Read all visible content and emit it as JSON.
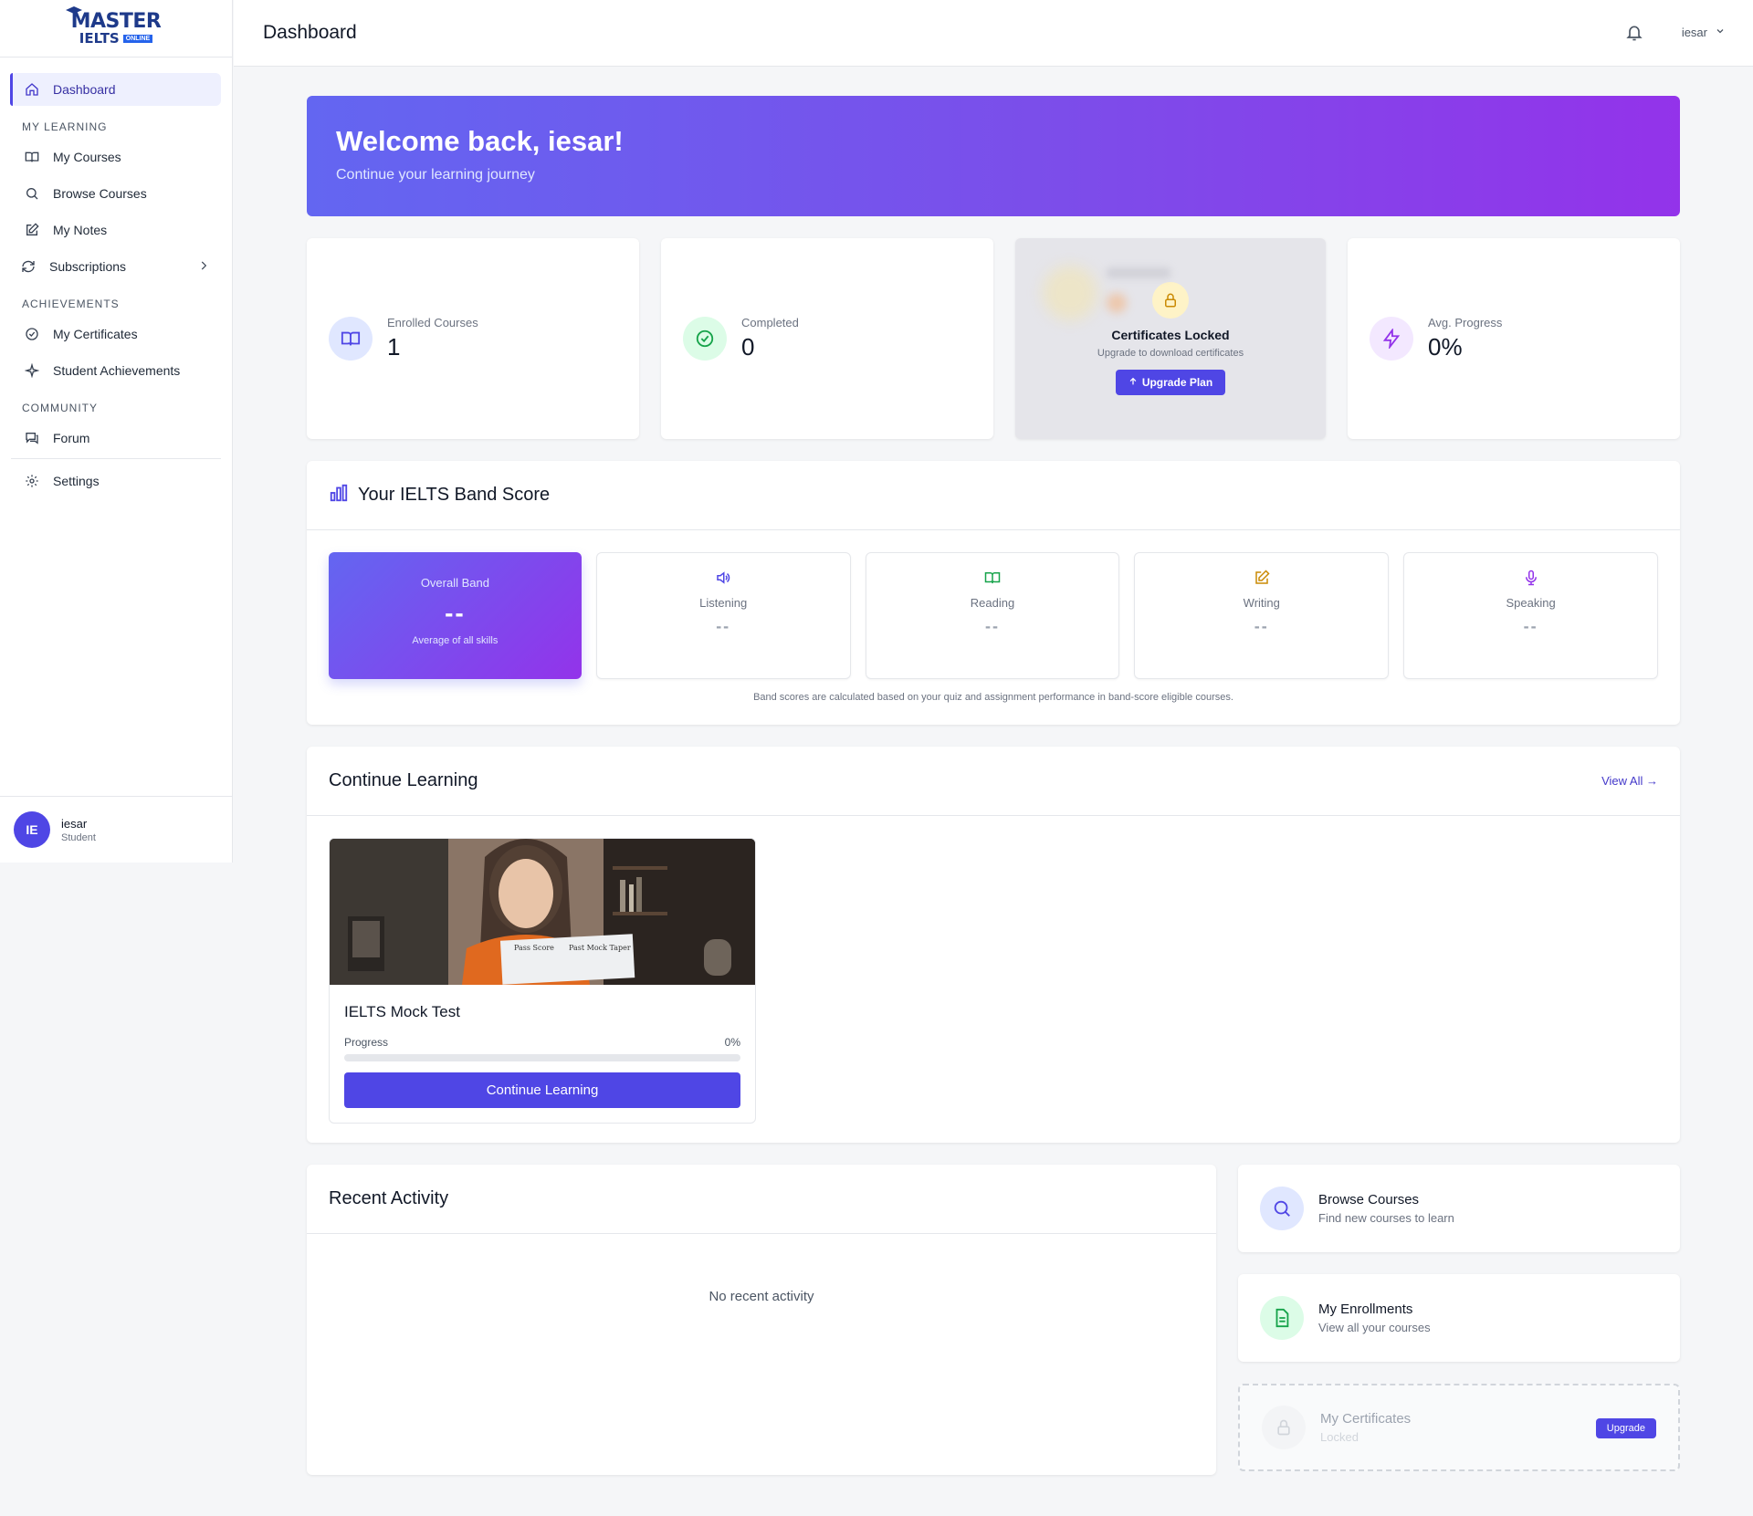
{
  "logo": {
    "master": "MASTER",
    "ielts": "IELTS",
    "online": "ONLINE"
  },
  "sidebar": {
    "dashboard": "Dashboard",
    "sections": {
      "learning": "MY LEARNING",
      "achievements": "ACHIEVEMENTS",
      "community": "COMMUNITY"
    },
    "items": {
      "my_courses": "My Courses",
      "browse_courses": "Browse Courses",
      "my_notes": "My Notes",
      "subscriptions": "Subscriptions",
      "my_certificates": "My Certificates",
      "student_achievements": "Student Achievements",
      "forum": "Forum",
      "settings": "Settings"
    },
    "user": {
      "initials": "IE",
      "name": "iesar",
      "role": "Student"
    }
  },
  "header": {
    "title": "Dashboard",
    "user": "iesar"
  },
  "welcome": {
    "title": "Welcome back, iesar!",
    "subtitle": "Continue your learning journey"
  },
  "stats": {
    "enrolled": {
      "label": "Enrolled Courses",
      "value": "1"
    },
    "completed": {
      "label": "Completed",
      "value": "0"
    },
    "certificates": {
      "title": "Certificates Locked",
      "subtitle": "Upgrade to download certificates",
      "button": "Upgrade Plan"
    },
    "progress": {
      "label": "Avg. Progress",
      "value": "0%"
    }
  },
  "band": {
    "title": "Your IELTS Band Score",
    "overall": {
      "label": "Overall Band",
      "value": "--",
      "sub": "Average of all skills"
    },
    "skills": [
      {
        "label": "Listening",
        "value": "--"
      },
      {
        "label": "Reading",
        "value": "--"
      },
      {
        "label": "Writing",
        "value": "--"
      },
      {
        "label": "Speaking",
        "value": "--"
      }
    ],
    "note": "Band scores are calculated based on your quiz and assignment performance in band-score eligible courses."
  },
  "continue_learning": {
    "title": "Continue Learning",
    "view_all": "View All →",
    "course": {
      "title": "IELTS Mock Test",
      "progress_label": "Progress",
      "progress_value": "0%",
      "progress_fraction": 0,
      "button": "Continue Learning",
      "image_text_left": "Pass Score",
      "image_text_right": "Past Mock Taper"
    }
  },
  "recent": {
    "title": "Recent Activity",
    "empty": "No recent activity"
  },
  "quick": {
    "browse": {
      "title": "Browse Courses",
      "sub": "Find new courses to learn"
    },
    "enrollments": {
      "title": "My Enrollments",
      "sub": "View all your courses"
    },
    "certificates": {
      "title": "My Certificates",
      "sub": "Locked",
      "button": "Upgrade"
    }
  },
  "colors": {
    "accent": "#4f46e5",
    "gradient_start": "#6366f1",
    "gradient_end": "#9333ea"
  }
}
